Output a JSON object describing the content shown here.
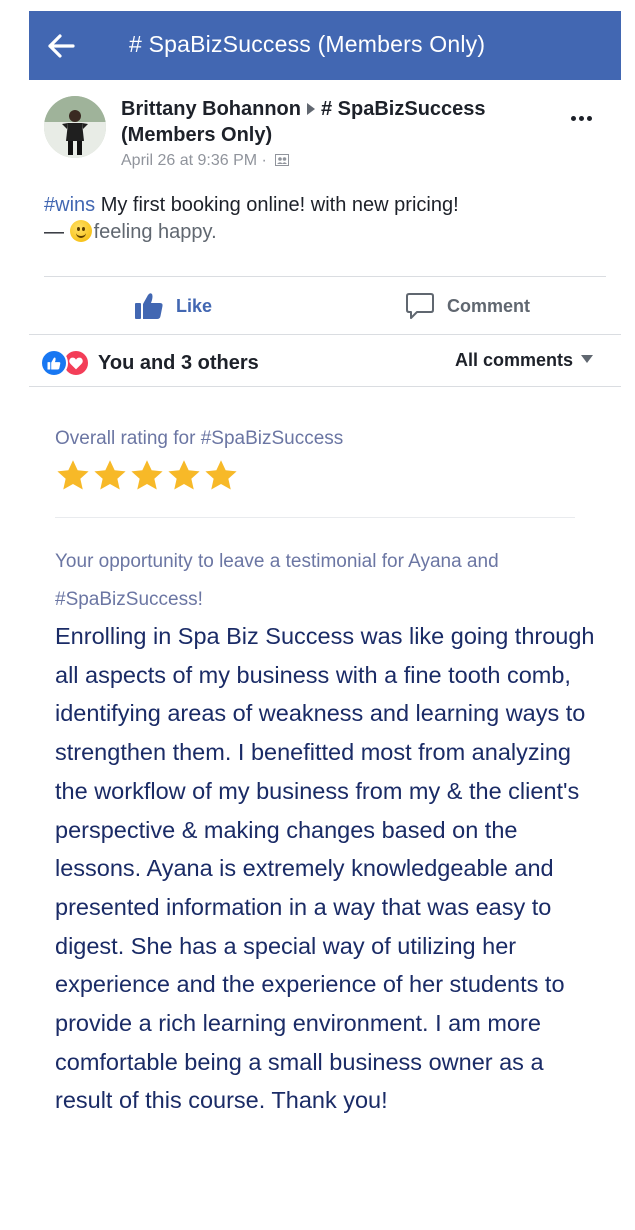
{
  "header": {
    "title": "# SpaBizSuccess (Members Only)",
    "back_icon": "back-arrow-icon"
  },
  "post": {
    "author": "Brittany Bohannon",
    "group": "# SpaBizSuccess (Members Only)",
    "timestamp": "April 26 at 9:36 PM ·",
    "hashtag": "#wins",
    "text": " My first booking online! with new pricing!",
    "feeling_prefix": "— ",
    "feeling": "feeling happy."
  },
  "actions": {
    "like_label": "Like",
    "comment_label": "Comment"
  },
  "reactions": {
    "summary": "You and 3 others",
    "filter_label": "All comments"
  },
  "rating": {
    "label": "Overall rating for #SpaBizSuccess",
    "stars": 5,
    "max_stars": 5,
    "star_color": "#f7b928"
  },
  "testimonial": {
    "prompt": "Your opportunity to leave a testimonial for Ayana and #SpaBizSuccess!",
    "body": "Enrolling in Spa Biz Success was like going through all aspects of my business with a fine tooth comb, identifying areas of weakness and learning ways to strengthen them. I benefitted most from analyzing the workflow of my business from my & the client's perspective & making changes based on the lessons. Ayana is extremely knowledgeable and presented information in a way that was easy to digest. She has a special way of utilizing her experience and the experience of her students to provide a rich learning environment. I am more comfortable being a small business owner as a result of this course. Thank you!"
  },
  "colors": {
    "header_bg": "#4267b2",
    "link_blue": "#4267b2",
    "love_red": "#f33e58"
  }
}
